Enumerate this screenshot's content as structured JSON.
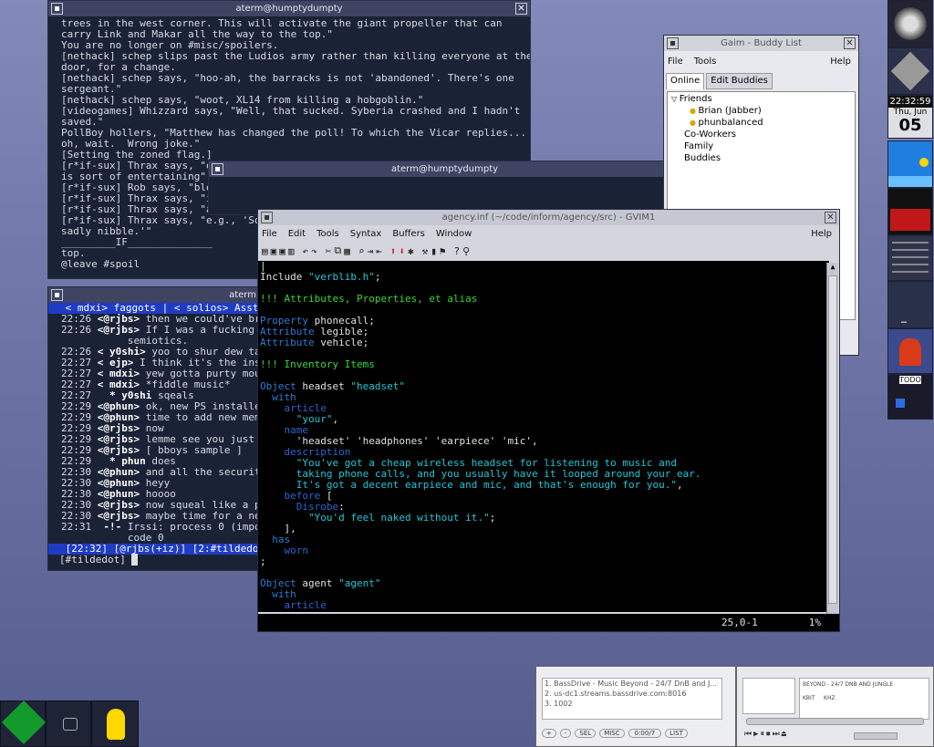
{
  "term1": {
    "title": "aterm@humptydumpty",
    "lines": [
      "trees in the west corner. This will activate the giant propeller that can",
      "carry Link and Makar all the way to the top.\"",
      "You are no longer on #misc/spoilers.",
      "[nethack] schep slips past the Ludios army rather than killing everyone at the",
      "door, for a change.",
      "[nethack] schep says, \"hoo-ah, the barracks is not 'abandoned'. There's one",
      "sergeant.\"",
      "[nethack] schep says, \"woot, XL14 from killing a hobgoblin.\"",
      "[videogames] Whizzard says, \"Well, that sucked. Syberia crashed and I hadn't",
      "saved.\"",
      "PollBoy hollers, \"Matthew has changed the poll! To which the Vicar replies...",
      "oh, wait.  Wrong joke.\"",
      "[Setting the zoned flag.]",
      "[r*if-sux] Thrax says, \"o",
      "is sort of entertaining\"",
      "[r*if-sux] Rob says, \"bleah\"",
      "[r*if-sux] Thrax says, \"it has the air of very forced anagrams\"",
      "[r*if-sux] Thrax says, \"and yet it doesn't seem to be\"",
      "[r*if-sux] Thrax says, \"e.g., 'Son",
      "sadly nibble.'\"",
      "_________IF______________",
      "top.",
      "@leave #spoil"
    ]
  },
  "term2": {
    "title": "aterm@humptydumpty"
  },
  "irc": {
    "title": "aterm",
    "topic": " < mdxi> faggots | < solios> Assta",
    "lines": [
      {
        "t": "22:26",
        "n": "<@rjbs>",
        "m": " then we could've bro"
      },
      {
        "t": "22:26",
        "n": "<@rjbs>",
        "m": " If I was a fucking f"
      },
      {
        "t": "",
        "n": "",
        "m": "           semiotics."
      },
      {
        "t": "22:26",
        "n": "< y0shi>",
        "m": " yoo to shur dew talk"
      },
      {
        "t": "22:27",
        "n": "< ejp>",
        "m": " I think it's the insar"
      },
      {
        "t": "22:27",
        "n": "< mdxi>",
        "m": " yew gotta purty mouf"
      },
      {
        "t": "22:27",
        "n": "< mdxi>",
        "m": " *fiddle music*"
      },
      {
        "t": "22:27",
        "n": "  * y0shi",
        "m": " sqeals"
      },
      {
        "t": "22:29",
        "n": "<@phun>",
        "m": " ok, new PS installed"
      },
      {
        "t": "22:29",
        "n": "<@phun>",
        "m": " time to add new memo"
      },
      {
        "t": "22:29",
        "n": "<@rjbs>",
        "m": " now"
      },
      {
        "t": "22:29",
        "n": "<@rjbs>",
        "m": " lemme see you just D"
      },
      {
        "t": "22:29",
        "n": "<@rjbs>",
        "m": " [ bboys sample ]"
      },
      {
        "t": "22:29",
        "n": "  * phun",
        "m": " does"
      },
      {
        "t": "22:30",
        "n": "<@phun>",
        "m": " and all the security"
      },
      {
        "t": "22:30",
        "n": "<@phun>",
        "m": " heyy"
      },
      {
        "t": "22:30",
        "n": "<@phun>",
        "m": " hoooo"
      },
      {
        "t": "22:30",
        "n": "<@rjbs>",
        "m": " now squeal like a pi"
      },
      {
        "t": "22:30",
        "n": "<@rjbs>",
        "m": " maybe time for a new"
      },
      {
        "t": "22:31",
        "n": " -!-",
        "m": " Irssi: process 0 (import"
      },
      {
        "t": "",
        "n": "",
        "m": "           code 0"
      }
    ],
    "status": " [22:32] [@rjbs(+iz)] [2:#tildedot",
    "prompt": "[#tildedot] "
  },
  "gaim": {
    "title": "Gaim - Buddy List",
    "menu": [
      "File",
      "Tools",
      "Help"
    ],
    "tabs": [
      "Online",
      "Edit Buddies"
    ],
    "groups": [
      {
        "name": "Friends",
        "buddies": [
          "Brian (Jabber)",
          "phunbalanced"
        ]
      },
      {
        "name": "Co-Workers",
        "buddies": []
      },
      {
        "name": "Family",
        "buddies": []
      },
      {
        "name": "Buddies",
        "buddies": []
      }
    ]
  },
  "gvim": {
    "title": "agency.inf (~/code/inform/agency/src) - GVIM1",
    "menu": [
      "File",
      "Edit",
      "Tools",
      "Syntax",
      "Buffers",
      "Window",
      "Help"
    ],
    "lines": [
      [
        [
          "",
          "|"
        ]
      ],
      [
        [
          "",
          "Include "
        ],
        [
          "str",
          "\"verblib.h\""
        ],
        [
          "",
          ";"
        ]
      ],
      [
        [
          "",
          ""
        ]
      ],
      [
        [
          "cm",
          "!!! Attributes, Properties, et alias"
        ]
      ],
      [
        [
          "",
          ""
        ]
      ],
      [
        [
          "kw",
          "Property"
        ],
        [
          "",
          " phonecall;"
        ]
      ],
      [
        [
          "kw",
          "Attribute"
        ],
        [
          "",
          " legible;"
        ]
      ],
      [
        [
          "kw",
          "Attribute"
        ],
        [
          "",
          " vehicle;"
        ]
      ],
      [
        [
          "",
          ""
        ]
      ],
      [
        [
          "cm",
          "!!! Inventory Items"
        ]
      ],
      [
        [
          "",
          ""
        ]
      ],
      [
        [
          "kw",
          "Object"
        ],
        [
          "",
          " headset "
        ],
        [
          "str",
          "\"headset\""
        ]
      ],
      [
        [
          "kw",
          "  with"
        ]
      ],
      [
        [
          "prop",
          "    article"
        ]
      ],
      [
        [
          "str",
          "      \"your\""
        ],
        [
          "",
          ","
        ]
      ],
      [
        [
          "prop",
          "    name"
        ]
      ],
      [
        [
          "",
          "      'headset' 'headphones' 'earpiece' 'mic',"
        ]
      ],
      [
        [
          "prop",
          "    description"
        ]
      ],
      [
        [
          "str",
          "      \"You've got a cheap wireless headset for listening to music and"
        ]
      ],
      [
        [
          "str",
          "      taking phone calls, and you usually have it looped around your ear."
        ]
      ],
      [
        [
          "str",
          "      It's got a decent earpiece and mic, and that's enough for you.\""
        ],
        [
          "",
          ","
        ]
      ],
      [
        [
          "prop",
          "    before"
        ],
        [
          "",
          " ["
        ]
      ],
      [
        [
          "prop",
          "      Disrobe"
        ],
        [
          "",
          ":"
        ]
      ],
      [
        [
          "str",
          "        \"You'd feel naked without it.\""
        ],
        [
          "",
          ";"
        ]
      ],
      [
        [
          "",
          "    ],"
        ]
      ],
      [
        [
          "kw",
          "  has"
        ]
      ],
      [
        [
          "prop",
          "    worn"
        ]
      ],
      [
        [
          "",
          ";"
        ]
      ],
      [
        [
          "",
          ""
        ]
      ],
      [
        [
          "kw",
          "Object"
        ],
        [
          "",
          " agent "
        ],
        [
          "str",
          "\"agent\""
        ]
      ],
      [
        [
          "kw",
          "  with"
        ]
      ],
      [
        [
          "prop",
          "    article"
        ]
      ]
    ],
    "status_pos": "25,0-1",
    "status_pct": "1%"
  },
  "dock": {
    "clock": "22:32:59",
    "date_day": "Thu, Jun",
    "date_num": "05",
    "todo": "TODO"
  },
  "xmms": {
    "playlist": [
      "1. BassDrive - Music Beyond - 24/7 DnB and J...",
      "2. us-dc1.streams.bassdrive.com:8016",
      "3. 1002"
    ],
    "marquee": "BEYOND - 24/7 DNB AND JUNGLE",
    "kbps": "KBIT",
    "khz": "KHZ",
    "time": "0:00/7",
    "buttons": [
      "+",
      "-",
      "SEL",
      "MISC",
      "LIST"
    ]
  },
  "taskbar": {
    "items": [
      "vim",
      "terminal",
      "tux"
    ]
  }
}
